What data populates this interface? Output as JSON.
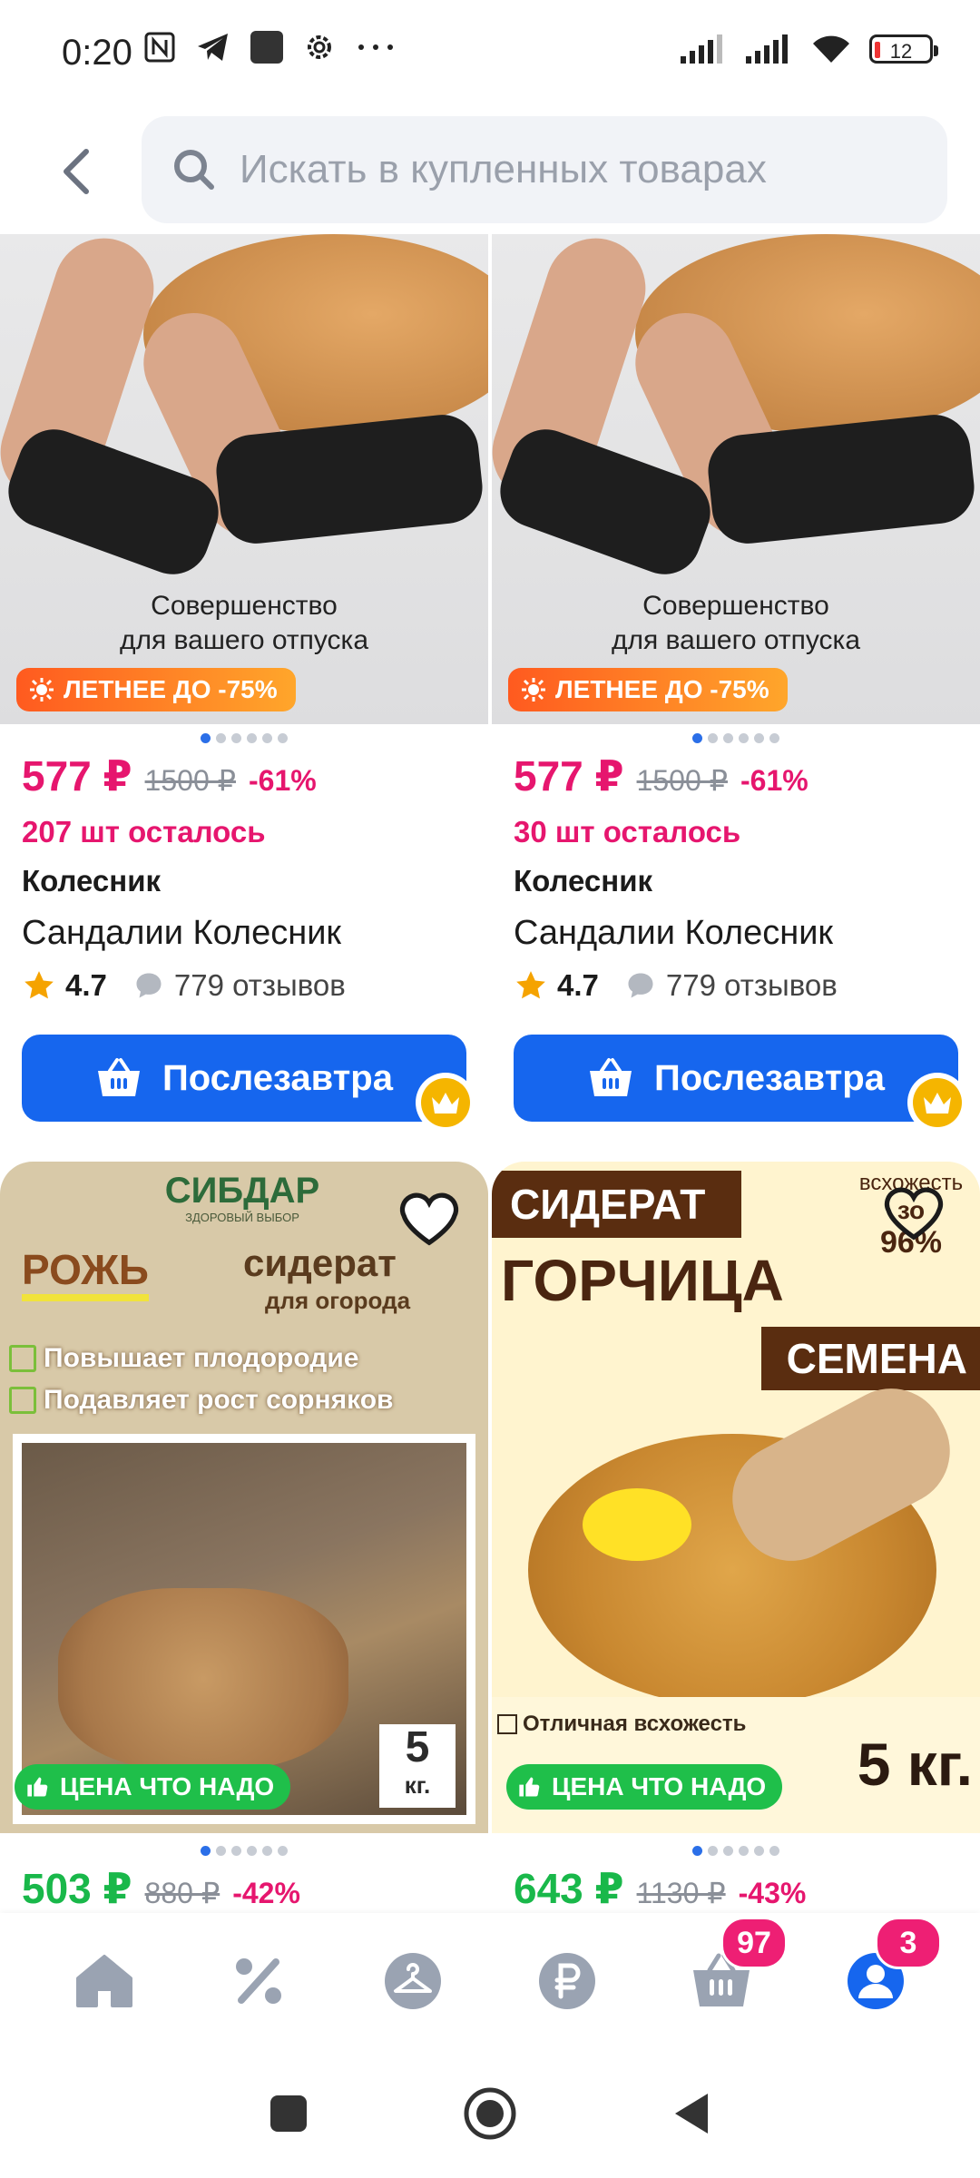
{
  "status_bar": {
    "time": "0:20",
    "battery": "12"
  },
  "search": {
    "placeholder": "Искать в купленных товарах"
  },
  "products": [
    {
      "promo_line1": "Совершенство",
      "promo_line2": "для вашего отпуска",
      "promo_badge": "ЛЕТНЕЕ ДО -75%",
      "price": "577 ₽",
      "old_price": "1500 ₽",
      "discount": "-61%",
      "stock": "207 шт осталось",
      "brand": "Колесник",
      "title": "Сандалии Колесник",
      "rating": "4.7",
      "reviews": "779 отзывов",
      "delivery": "Послезавтра"
    },
    {
      "promo_line1": "Совершенство",
      "promo_line2": "для вашего отпуска",
      "promo_badge": "ЛЕТНЕЕ ДО -75%",
      "price": "577 ₽",
      "old_price": "1500 ₽",
      "discount": "-61%",
      "stock": "30 шт осталось",
      "brand": "Колесник",
      "title": "Сандалии Колесник",
      "rating": "4.7",
      "reviews": "779 отзывов",
      "delivery": "Послезавтра"
    },
    {
      "img_logo": "СИБДАР",
      "img_logo_sub": "ЗДОРОВЫЙ ВЫБОР",
      "img_word1": "РОЖЬ",
      "img_word2": "сидерат",
      "img_word3": "для огорода",
      "img_bullet1": "Повышает плодородие",
      "img_bullet2": "Подавляет рост сорняков",
      "img_weight": "5",
      "img_weight_unit": "кг.",
      "chip": "ЦЕНА ЧТО НАДО",
      "price": "503 ₽",
      "old_price": "880 ₽",
      "discount": "-42%"
    },
    {
      "img_top": "СИДЕРАТ",
      "img_main": "ГОРЧИЦА",
      "img_seeds": "СЕМЕНА",
      "img_corner1": "всхожесть",
      "img_corner2": "зо",
      "img_corner3": "96%",
      "img_bullet1": "Отличная всхожесть",
      "img_weight": "5 кг.",
      "chip": "ЦЕНА ЧТО НАДО",
      "price": "643 ₽",
      "old_price": "1130 ₽",
      "discount": "-43%"
    }
  ],
  "nav": {
    "cart_badge": "97",
    "profile_badge": "3"
  }
}
